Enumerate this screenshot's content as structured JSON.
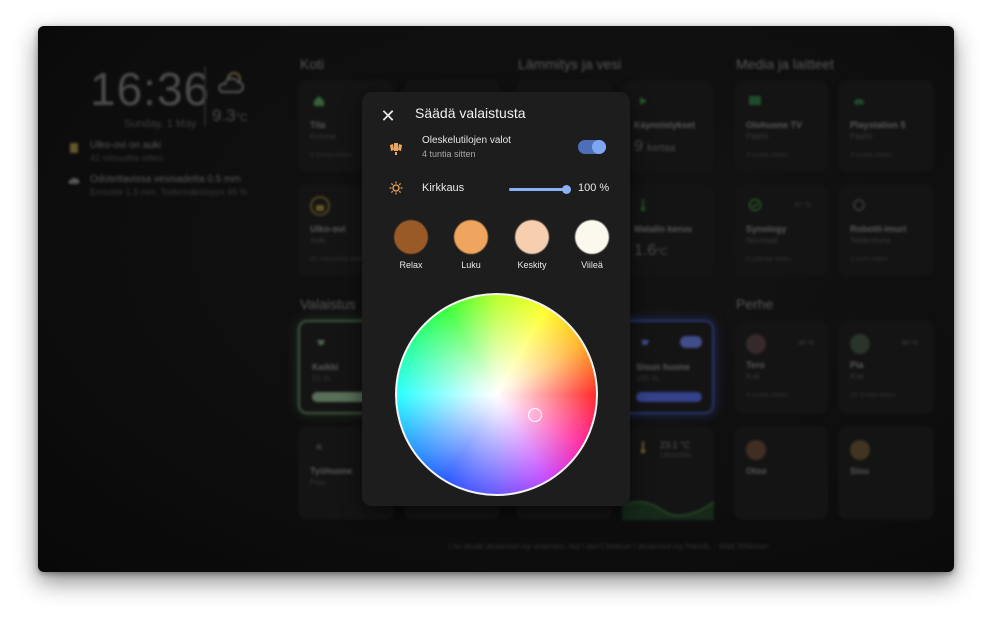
{
  "dashboard": {
    "clock": "16:36",
    "date": "Sunday, 1 May",
    "weather": {
      "temp": "9.3",
      "unit": "°C",
      "icon": "partly-cloudy-icon"
    },
    "notifications": [
      {
        "title": "Ulko-ovi on auki",
        "sub": "41 minuuttia sitten",
        "icon": "door-icon"
      },
      {
        "title": "Odotettavissa vesisadetta 0.5 mm",
        "sub": "Ennuste 1.3 mm. Todennäköisyys 49 %",
        "icon": "rain-cloud-icon"
      }
    ],
    "sections": {
      "koti": "Koti",
      "lammitys": "Lämmitys ja vesi",
      "media": "Media ja laitteet",
      "valaistus": "Valaistus",
      "perhe": "Perhe"
    },
    "cards": {
      "tila": {
        "title": "Tila",
        "sub": "Kotona",
        "foot": "8 tuntia sitten"
      },
      "ulkoovi": {
        "title": "Ulko-ovi",
        "sub": "Auki",
        "foot": "41 minuuttia sitten"
      },
      "kaynnistykset": {
        "title": "Käynnistykset",
        "sub": "",
        "big": "9",
        "unit": "kertaa"
      },
      "matalin": {
        "title": "Matalin keruu",
        "big": "1.6",
        "unit": "°C"
      },
      "olohuone_tv": {
        "title": "Olohuone TV",
        "sub": "Päällä",
        "foot": "3 tuntia sitten"
      },
      "ps5": {
        "title": "Playstation 5",
        "sub": "Päällä",
        "foot": "3 tuntia sitten"
      },
      "synology": {
        "title": "Synology",
        "sub": "Normaali",
        "badge": "37 °C",
        "foot": "3 päivää sitten"
      },
      "robotti": {
        "title": "Robotti-imuri",
        "sub": "Telakoituna",
        "foot": "1 tunti sitten"
      },
      "kaikki": {
        "title": "Kaikki",
        "sub": "51 %"
      },
      "tyohuone": {
        "title": "Työhuone",
        "sub": "Pois"
      },
      "sisun_huone": {
        "title": "Sisun huone",
        "sub": "100 %"
      },
      "lampotila": {
        "title": "23.1 °C",
        "sub": "Lämpötila"
      },
      "tero": {
        "title": "Tero",
        "sub": "Koti",
        "pct": "46 %",
        "foot": "4 tuntia sitten"
      },
      "pia": {
        "title": "Pia",
        "sub": "Koti",
        "pct": "80 %",
        "foot": "21 tuntia sitten"
      },
      "otso": {
        "title": "Otso"
      },
      "sisu": {
        "title": "Sisu"
      }
    },
    "quote": "I no doubt deserved my enemies, but I don't believe I deserved my friends. - Walt Whitman"
  },
  "dialog": {
    "title": "Säädä valaistusta",
    "light": {
      "name": "Oleskelutilojen valot",
      "sub": "4 tuntia sitten",
      "on": true
    },
    "brightness": {
      "label": "Kirkkaus",
      "value": "100 %",
      "fraction": 1.0
    },
    "presets": [
      {
        "label": "Relax",
        "color": "#9a5a28"
      },
      {
        "label": "Luku",
        "color": "#f0a55e"
      },
      {
        "label": "Keskity",
        "color": "#f8cfae"
      },
      {
        "label": "Viileä",
        "color": "#fbf8ee"
      }
    ]
  }
}
